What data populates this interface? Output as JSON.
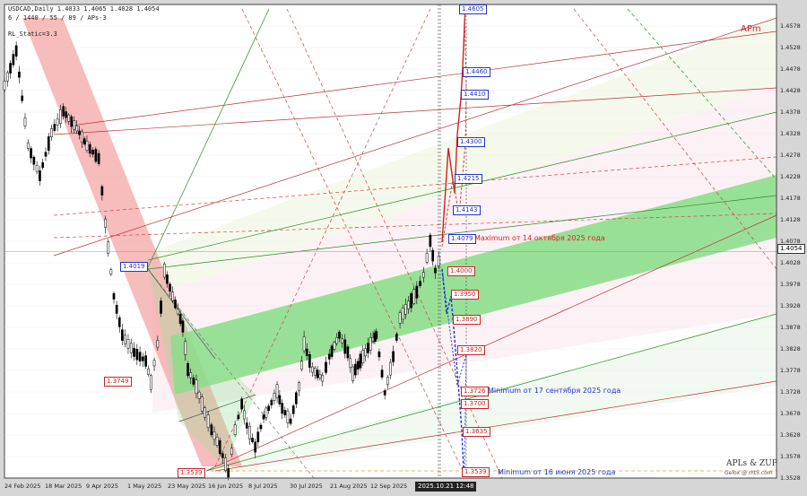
{
  "window": {
    "symbol_line": "USDCAD,Daily  1.4033 1.4065 1.4028 1.4054",
    "params_line": "6 / 1440 / 55 / 89 / APs-3",
    "indicator_line": "RL_Static=3.3",
    "apm_label": "APm",
    "current_price_tag": "1.4054",
    "cursor_date_tag": "2025.10.21 12:48",
    "watermark_line1": "APLs & ZUP",
    "watermark_line2": "Gelox @ mt5.com",
    "colors": {
      "bg": "#ffffff",
      "bull": "#ffffff",
      "bear": "#000000",
      "green_channel": "#7fdc7f",
      "pink_channel": "#f4a5a5",
      "target_red": "#cc2222",
      "target_blue": "#2233cc"
    }
  },
  "annotations": {
    "max_note": "Maximum от 14 октября 2025 года",
    "min_sep_note": "Minimum от 17 сентября 2025 года",
    "min_jun_note": "Minimum от 16 июня 2025 года"
  },
  "chart_data": {
    "type": "candlestick",
    "ylim": [
      1.3528,
      1.4628
    ],
    "y_ticks": [
      "1.4578",
      "1.4528",
      "1.4478",
      "1.4428",
      "1.4378",
      "1.4328",
      "1.4278",
      "1.4228",
      "1.4178",
      "1.4128",
      "1.4078",
      "1.4028",
      "1.3978",
      "1.3928",
      "1.3878",
      "1.3828",
      "1.3778",
      "1.3728",
      "1.3678",
      "1.3628",
      "1.3578",
      "1.3528"
    ],
    "x_ticks": [
      "24 Feb 2025",
      "18 Mar 2025",
      "9 Apr 2025",
      "1 May 2025",
      "23 May 2025",
      "16 Jun 2025",
      "8 Jul 2025",
      "30 Jul 2025",
      "21 Aug 2025",
      "12 Sep 2025",
      "2025.10.21 12:48"
    ],
    "price_path": [
      [
        "2025-02-03",
        1.444
      ],
      [
        "2025-02-10",
        1.452
      ],
      [
        "2025-02-17",
        1.43
      ],
      [
        "2025-02-24",
        1.423
      ],
      [
        "2025-03-03",
        1.433
      ],
      [
        "2025-03-10",
        1.438
      ],
      [
        "2025-03-18",
        1.434
      ],
      [
        "2025-03-24",
        1.43
      ],
      [
        "2025-03-31",
        1.427
      ],
      [
        "2025-04-04",
        1.412
      ],
      [
        "2025-04-09",
        1.395
      ],
      [
        "2025-04-14",
        1.386
      ],
      [
        "2025-04-21",
        1.382
      ],
      [
        "2025-04-28",
        1.38
      ],
      [
        "2025-05-01",
        1.375
      ],
      [
        "2025-05-05",
        1.384
      ],
      [
        "2025-05-09",
        1.401
      ],
      [
        "2025-05-14",
        1.395
      ],
      [
        "2025-05-20",
        1.388
      ],
      [
        "2025-05-23",
        1.378
      ],
      [
        "2025-05-28",
        1.374
      ],
      [
        "2025-06-02",
        1.368
      ],
      [
        "2025-06-06",
        1.364
      ],
      [
        "2025-06-11",
        1.36
      ],
      [
        "2025-06-16",
        1.354
      ],
      [
        "2025-06-20",
        1.364
      ],
      [
        "2025-06-24",
        1.37
      ],
      [
        "2025-06-27",
        1.365
      ],
      [
        "2025-07-02",
        1.36
      ],
      [
        "2025-07-07",
        1.367
      ],
      [
        "2025-07-10",
        1.369
      ],
      [
        "2025-07-15",
        1.373
      ],
      [
        "2025-07-18",
        1.369
      ],
      [
        "2025-07-23",
        1.366
      ],
      [
        "2025-07-28",
        1.374
      ],
      [
        "2025-07-31",
        1.384
      ],
      [
        "2025-08-05",
        1.378
      ],
      [
        "2025-08-11",
        1.376
      ],
      [
        "2025-08-15",
        1.381
      ],
      [
        "2025-08-21",
        1.386
      ],
      [
        "2025-08-26",
        1.382
      ],
      [
        "2025-08-29",
        1.377
      ],
      [
        "2025-09-04",
        1.381
      ],
      [
        "2025-09-10",
        1.385
      ],
      [
        "2025-09-12",
        1.386
      ],
      [
        "2025-09-17",
        1.3726
      ],
      [
        "2025-09-22",
        1.381
      ],
      [
        "2025-09-26",
        1.39
      ],
      [
        "2025-10-01",
        1.393
      ],
      [
        "2025-10-06",
        1.396
      ],
      [
        "2025-10-10",
        1.4
      ],
      [
        "2025-10-14",
        1.4079
      ],
      [
        "2025-10-17",
        1.401
      ],
      [
        "2025-10-21",
        1.4054
      ]
    ],
    "targets_red": [
      "1.4605",
      "1.4460",
      "1.4410",
      "1.4300",
      "1.4000",
      "1.3950",
      "1.3890",
      "1.3820",
      "1.3726",
      "1.3700",
      "1.3635",
      "1.3539"
    ],
    "targets_blue": [
      "1.4215",
      "1.4143",
      "1.4079",
      "1.4019",
      "1.3749"
    ],
    "grid": true
  }
}
